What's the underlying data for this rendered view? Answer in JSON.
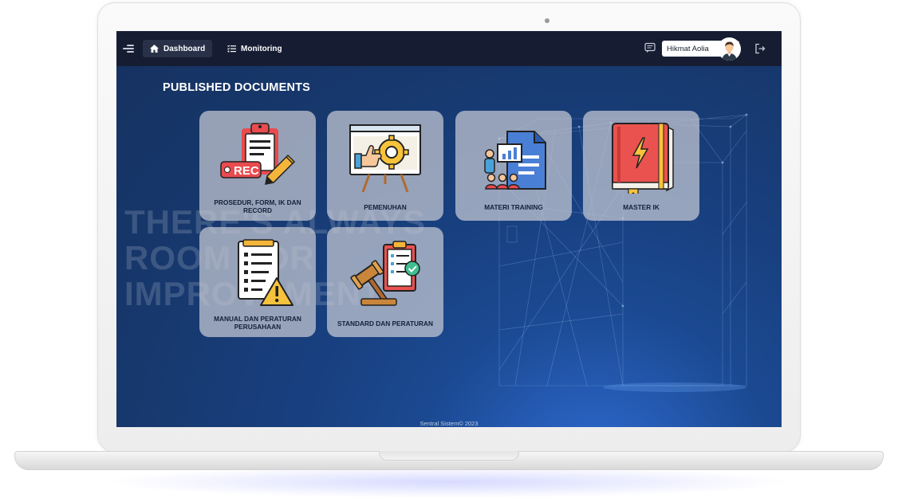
{
  "topbar": {
    "nav": [
      {
        "label": "Dashboard",
        "icon": "home-icon",
        "active": true
      },
      {
        "label": "Monitoring",
        "icon": "list-check-icon",
        "active": false
      }
    ],
    "user_name": "Hikmat Aolia"
  },
  "background_text": [
    "THERE'S ALWAYS",
    "ROOM FOR",
    "IMPROVEMENT"
  ],
  "main": {
    "section_title": "PUBLISHED DOCUMENTS",
    "cards": [
      {
        "label": "PROSEDUR, FORM, IK DAN RECORD",
        "icon": "clipboard-rec-icon"
      },
      {
        "label": "PEMENUHAN",
        "icon": "presentation-gear-icon"
      },
      {
        "label": "MATERI TRAINING",
        "icon": "training-document-icon"
      },
      {
        "label": "MASTER IK",
        "icon": "red-book-icon"
      },
      {
        "label": "MANUAL DAN PERATURAN PERUSAHAAN",
        "icon": "checklist-warning-icon"
      },
      {
        "label": "STANDARD DAN PERATURAN",
        "icon": "gavel-checklist-icon"
      }
    ]
  },
  "footer": {
    "text": "Sentral Sistem© 2023"
  },
  "colors": {
    "topbar": "#161d33",
    "screen_bg": "#183f7e",
    "card_bg": "#c8cad4",
    "active_nav": "#283148"
  }
}
